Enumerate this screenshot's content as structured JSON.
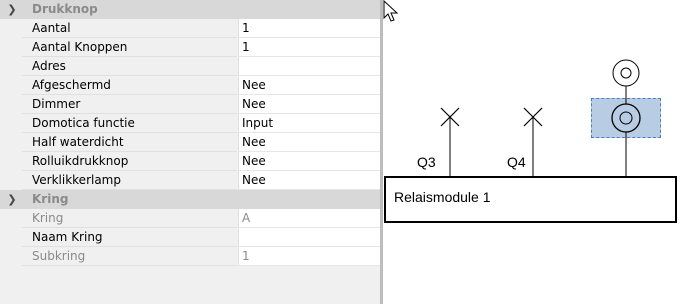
{
  "categories": [
    {
      "label": "Drukknop",
      "chevron": "chevron-down-icon",
      "rows": [
        {
          "name": "Aantal",
          "value": "1"
        },
        {
          "name": "Aantal Knoppen",
          "value": "1"
        },
        {
          "name": "Adres",
          "value": ""
        },
        {
          "name": "Afgeschermd",
          "value": "Nee"
        },
        {
          "name": "Dimmer",
          "value": "Nee"
        },
        {
          "name": "Domotica functie",
          "value": "Input"
        },
        {
          "name": "Half waterdicht",
          "value": "Nee"
        },
        {
          "name": "Rolluikdrukknop",
          "value": "Nee"
        },
        {
          "name": "Verklikkerlamp",
          "value": "Nee"
        }
      ]
    },
    {
      "label": "Kring",
      "chevron": "chevron-down-icon",
      "rows": [
        {
          "name": "Kring",
          "value": "A",
          "disabled": true
        },
        {
          "name": "Naam Kring",
          "value": ""
        },
        {
          "name": "Subkring",
          "value": "1",
          "disabled": true
        }
      ]
    }
  ],
  "diagram": {
    "outputs": [
      {
        "label": "Q3",
        "symbol": "cross-icon"
      },
      {
        "label": "Q4",
        "symbol": "cross-icon"
      }
    ],
    "module_label": "Relaismodule 1",
    "selection_color": "#b8cce4",
    "selection_border": "#4a7fc1"
  }
}
